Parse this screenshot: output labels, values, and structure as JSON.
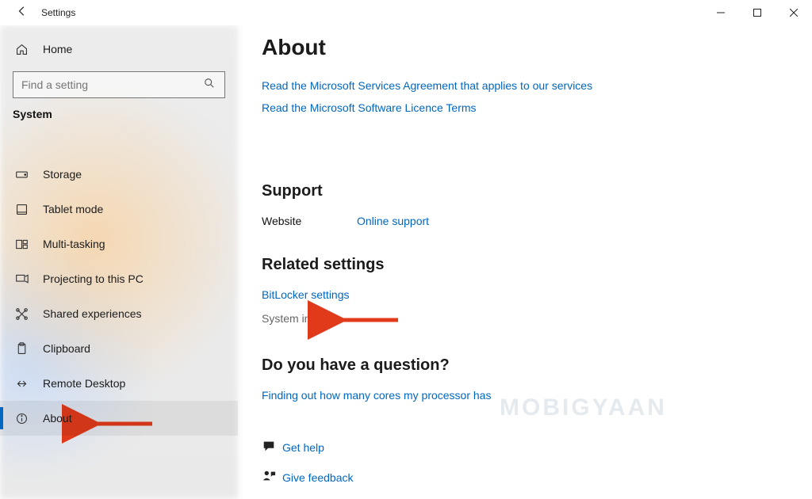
{
  "window": {
    "title": "Settings"
  },
  "sidebar": {
    "home": "Home",
    "search_placeholder": "Find a setting",
    "section": "System",
    "items": [
      {
        "label": "Storage"
      },
      {
        "label": "Tablet mode"
      },
      {
        "label": "Multi-tasking"
      },
      {
        "label": "Projecting to this PC"
      },
      {
        "label": "Shared experiences"
      },
      {
        "label": "Clipboard"
      },
      {
        "label": "Remote Desktop"
      },
      {
        "label": "About"
      }
    ]
  },
  "content": {
    "title": "About",
    "links_top": [
      "Read the Microsoft Services Agreement that applies to our services",
      "Read the Microsoft Software Licence Terms"
    ],
    "support": {
      "heading": "Support",
      "website_label": "Website",
      "website_link": "Online support"
    },
    "related": {
      "heading": "Related settings",
      "bitlocker": "BitLocker settings",
      "system_info": "System info"
    },
    "question": {
      "heading": "Do you have a question?",
      "link": "Finding out how many cores my processor has"
    },
    "help": {
      "get_help": "Get help",
      "give_feedback": "Give feedback"
    }
  },
  "watermark": "MOBIGYAAN"
}
